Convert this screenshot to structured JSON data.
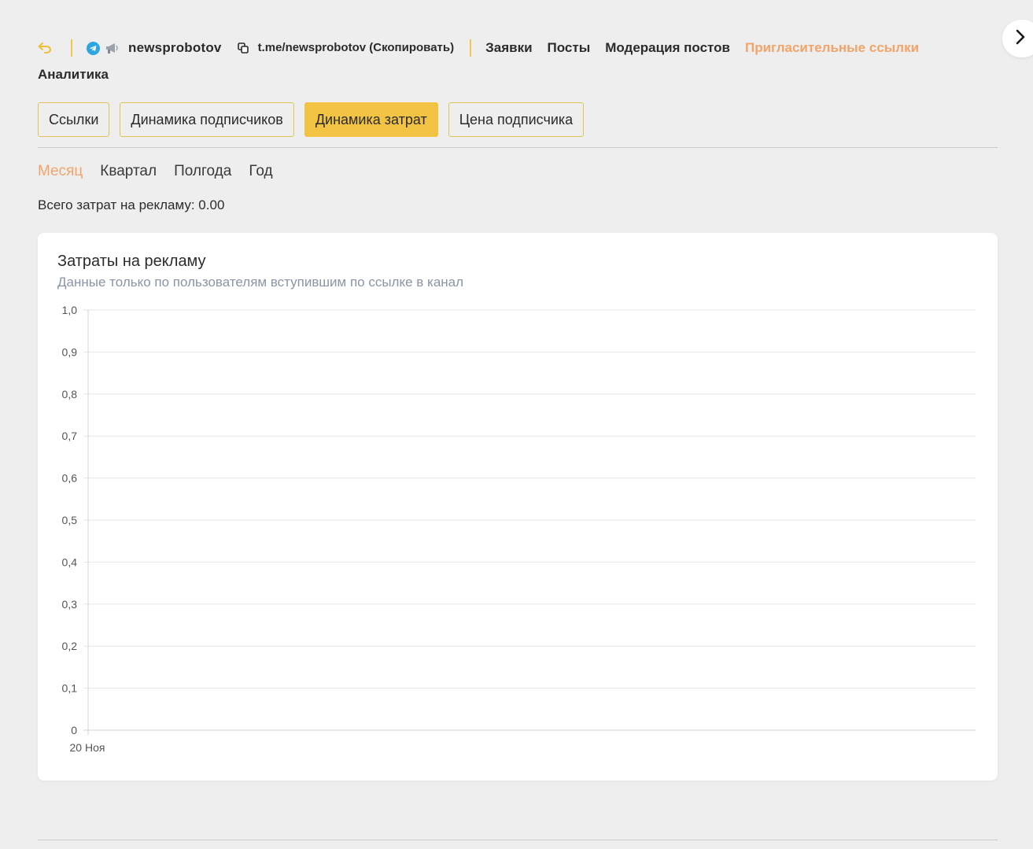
{
  "header": {
    "channel_name": "newsprobotov",
    "channel_link": "t.me/newsprobotov (Скопировать)",
    "nav_items": [
      {
        "label": "Заявки",
        "active": false
      },
      {
        "label": "Посты",
        "active": false
      },
      {
        "label": "Модерация постов",
        "active": false
      },
      {
        "label": "Пригласительные ссылки",
        "active": true
      }
    ],
    "nav_second_row": "Аналитика"
  },
  "tabs": [
    {
      "label": "Ссылки",
      "active": false
    },
    {
      "label": "Динамика подписчиков",
      "active": false
    },
    {
      "label": "Динамика затрат",
      "active": true
    },
    {
      "label": "Цена подписчика",
      "active": false
    }
  ],
  "periods": [
    {
      "label": "Месяц",
      "active": true
    },
    {
      "label": "Квартал",
      "active": false
    },
    {
      "label": "Полгода",
      "active": false
    },
    {
      "label": "Год",
      "active": false
    }
  ],
  "total_label": "Всего затрат на рекламу: 0.00",
  "colors": {
    "accent_yellow": "#f3c443",
    "accent_orange": "#f2a46a",
    "background": "#eeeeee"
  },
  "chart_data": {
    "type": "line",
    "title": "Затраты на рекламу",
    "subtitle": "Данные только по пользователям вступившим по ссылке в канал",
    "x": [
      "20 Ноя"
    ],
    "series": [
      {
        "values": []
      }
    ],
    "ylim": [
      0,
      1
    ],
    "yticks": [
      "0",
      "0,1",
      "0,2",
      "0,3",
      "0,4",
      "0,5",
      "0,6",
      "0,7",
      "0,8",
      "0,9",
      "1,0"
    ],
    "grid": true
  }
}
